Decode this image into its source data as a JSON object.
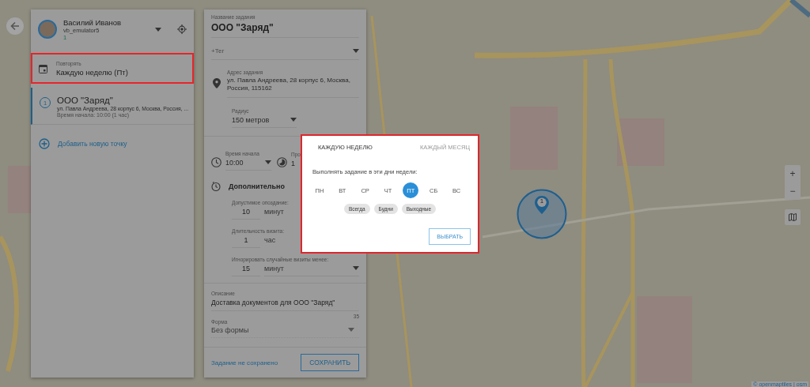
{
  "user": {
    "name": "Василий Иванов",
    "login": "vb_emulator5",
    "count": "1"
  },
  "repeat": {
    "label": "Повторять",
    "value": "Каждую неделю (Пт)"
  },
  "points": [
    {
      "number": "1",
      "title": "ООО \"Заряд\"",
      "address": "ул. Павла Андреева, 28 корпус 6, Москва, Россия, ...",
      "time": "Время начала: 10:00 (1 час)",
      "selected": true
    }
  ],
  "add_point": "Добавить новую точку",
  "task": {
    "name": {
      "label": "Название задания",
      "value": "ООО \"Заряд\""
    },
    "tag": {
      "placeholder": "+Тег"
    },
    "address": {
      "label": "Адрес задания",
      "value": "ул. Павла Андреева, 28 корпус 6, Москва, Россия, 115162"
    },
    "radius": {
      "label": "Радиус",
      "value": "150 метров"
    },
    "start_time": {
      "label": "Время начала",
      "value": "10:00"
    },
    "duration": {
      "label": "Про",
      "value": "1"
    },
    "extra_title": "Дополнительно",
    "extra_fields": [
      {
        "label": "Допустимое опоздание:",
        "value": "10",
        "unit": "минут",
        "dropdown": false
      },
      {
        "label": "Длительность визита:",
        "value": "1",
        "unit": "час",
        "dropdown": false
      },
      {
        "label": "Игнорировать случайные визиты менее:",
        "value": "15",
        "unit": "минут",
        "dropdown": true
      }
    ],
    "description": {
      "label": "Описание",
      "value": "Доставка документов для ООО \"Заряд\"",
      "counter": "35"
    },
    "form": {
      "label": "Форма",
      "value": "Без формы",
      "disabled": true
    },
    "status": "Задание не сохранено",
    "save": "СОХРАНИТЬ"
  },
  "modal": {
    "tabs": [
      {
        "label": "КАЖДУЮ НЕДЕЛЮ",
        "selected": true
      },
      {
        "label": "КАЖДЫЙ МЕСЯЦ",
        "selected": false
      }
    ],
    "prompt": "Выполнять задание в эти дни недели:",
    "days": [
      {
        "label": "ПН",
        "selected": false
      },
      {
        "label": "ВТ",
        "selected": false
      },
      {
        "label": "СР",
        "selected": false
      },
      {
        "label": "ЧТ",
        "selected": false
      },
      {
        "label": "ПТ",
        "selected": true
      },
      {
        "label": "СБ",
        "selected": false
      },
      {
        "label": "ВС",
        "selected": false
      }
    ],
    "presets": [
      "Всегда",
      "Будни",
      "Выходные"
    ],
    "button": "ВЫБРАТЬ"
  },
  "map": {
    "marker": "1",
    "zoom_in": "+",
    "zoom_out": "−",
    "attribution": "© openmaptiles | osm"
  }
}
